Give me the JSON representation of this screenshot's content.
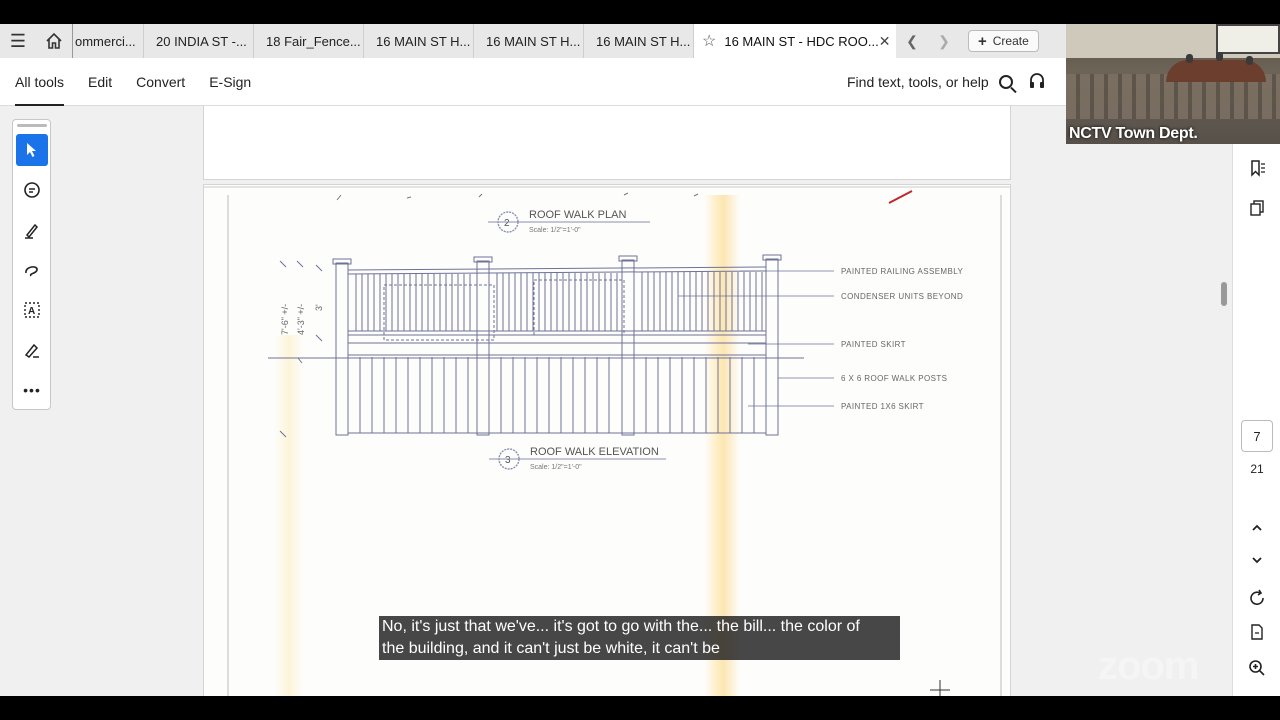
{
  "tabs": {
    "items": [
      {
        "label": "ommerci..."
      },
      {
        "label": "20 INDIA ST -..."
      },
      {
        "label": "18 Fair_Fence..."
      },
      {
        "label": "16 MAIN ST H..."
      },
      {
        "label": "16 MAIN ST H..."
      },
      {
        "label": "16 MAIN ST H..."
      }
    ],
    "active_label": "16 MAIN ST - HDC ROO...",
    "create_label": "Create"
  },
  "toolbar": {
    "menu": [
      "All tools",
      "Edit",
      "Convert",
      "E-Sign"
    ],
    "find_label": "Find text, tools, or help"
  },
  "document": {
    "roof_walk_plan": {
      "number": "2",
      "title": "ROOF WALK PLAN",
      "scale": "Scale: 1/2\"=1'-0\""
    },
    "roof_walk_elevation": {
      "number": "3",
      "title": "ROOF WALK ELEVATION",
      "scale": "Scale: 1/2\"=1'-0\""
    },
    "callouts": [
      "PAINTED RAILING ASSEMBLY",
      "CONDENSER UNITS BEYOND",
      "PAINTED SKIRT",
      "6 X 6 ROOF WALK POSTS",
      "PAINTED 1X6 SKIRT"
    ],
    "dimensions": [
      "7'-6\" +/-",
      "4'-3\" +/-",
      "3'"
    ]
  },
  "page_nav": {
    "current": "7",
    "total": "21"
  },
  "video": {
    "label": "NCTV Town Dept."
  },
  "caption": {
    "line1": "No, it's just that we've... it's got to go with the... the bill... the color of",
    "line2": "the building, and it can't just be white, it can't be"
  },
  "watermark": "zoom",
  "colors": {
    "accent": "#1a73e8",
    "drawing_ink": "#5a5f8a"
  }
}
